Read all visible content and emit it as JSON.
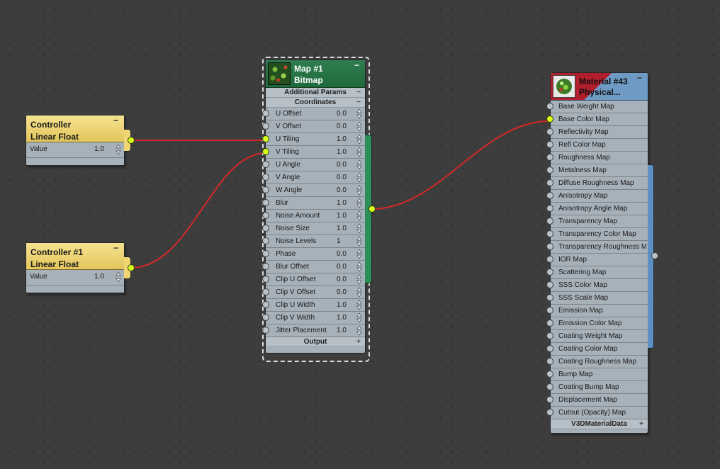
{
  "controller_a": {
    "line1": "Controller",
    "line2": "Linear Float",
    "param": "Value",
    "value": "1.0"
  },
  "controller_b": {
    "line1": "Controller #1",
    "line2": "Linear Float",
    "param": "Value",
    "value": "1.0"
  },
  "bitmap": {
    "line1": "Map #1",
    "line2": "Bitmap",
    "collapse_glyph": "−",
    "rollouts": {
      "additional": "Additional Params",
      "coordinates": "Coordinates",
      "output": "Output"
    },
    "params": [
      {
        "label": "U Offset",
        "value": "0.0"
      },
      {
        "label": "V Offset",
        "value": "0.0"
      },
      {
        "label": "U Tiling",
        "value": "1.0"
      },
      {
        "label": "V Tiling",
        "value": "1.0"
      },
      {
        "label": "U Angle",
        "value": "0.0"
      },
      {
        "label": "V Angle",
        "value": "0.0"
      },
      {
        "label": "W Angle",
        "value": "0.0"
      },
      {
        "label": "Blur",
        "value": "1.0"
      },
      {
        "label": "Noise Amount",
        "value": "1.0"
      },
      {
        "label": "Noise Size",
        "value": "1.0"
      },
      {
        "label": "Noise Levels",
        "value": "1"
      },
      {
        "label": "Phase",
        "value": "0.0"
      },
      {
        "label": "Blur Offset",
        "value": "0.0"
      },
      {
        "label": "Clip U Offset",
        "value": "0.0"
      },
      {
        "label": "Clip V Offset",
        "value": "0.0"
      },
      {
        "label": "Clip U Width",
        "value": "1.0"
      },
      {
        "label": "Clip V Width",
        "value": "1.0"
      },
      {
        "label": "Jitter Placement",
        "value": "1.0"
      }
    ]
  },
  "material": {
    "line1": "Material #43",
    "line2": "Physical...",
    "footer": "V3DMaterialData",
    "slots": [
      "Base Weight Map",
      "Base Color Map",
      "Reflectivity Map",
      "Refl Color Map",
      "Roughness Map",
      "Metalness Map",
      "Diffuse Roughness Map",
      "Anisotropy Map",
      "Anisotropy Angle Map",
      "Transparency Map",
      "Transparency Color Map",
      "Transparency Roughness Map",
      "IOR Map",
      "Scattering Map",
      "SSS Color Map",
      "SSS Scale Map",
      "Emission Map",
      "Emission Color Map",
      "Coating Weight Map",
      "Coating Color Map",
      "Coating Roughness Map",
      "Bump Map",
      "Coating Bump Map",
      "Displacement Map",
      "Cutout (Opacity) Map"
    ]
  },
  "colors": {
    "wire": "#d42828",
    "active_socket": "#d8ff1a",
    "controller_header": "#f0d672",
    "bitmap_header": "#2f7e4f",
    "material_header": "#b01f2b"
  }
}
